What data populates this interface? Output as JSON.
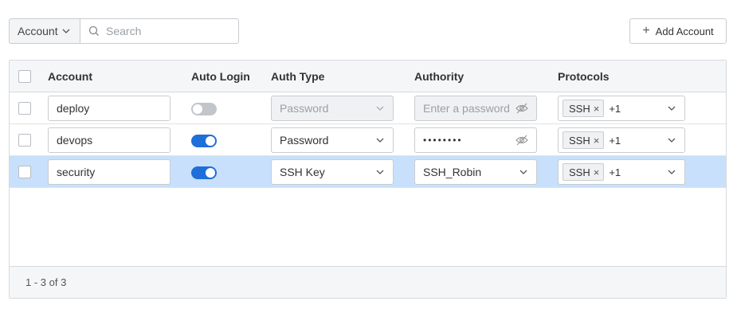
{
  "toolbar": {
    "filter_label": "Account",
    "search_placeholder": "Search",
    "add_button_label": "Add Account"
  },
  "table": {
    "columns": [
      "Account",
      "Auto Login",
      "Auth Type",
      "Authority",
      "Protocols"
    ],
    "rows": [
      {
        "account": "deploy",
        "auto_login": false,
        "auth_type": "Password",
        "auth_type_disabled": true,
        "authority_placeholder": "Enter a password",
        "authority_value": "",
        "protocol_tag": "SSH",
        "protocol_more": "+1",
        "selected": false
      },
      {
        "account": "devops",
        "auto_login": true,
        "auth_type": "Password",
        "auth_type_disabled": false,
        "authority_value": "••••••••",
        "protocol_tag": "SSH",
        "protocol_more": "+1",
        "selected": false
      },
      {
        "account": "security",
        "auto_login": true,
        "auth_type": "SSH Key",
        "auth_type_disabled": false,
        "authority_value": "SSH_Robin",
        "protocol_tag": "SSH",
        "protocol_more": "+1",
        "selected": true
      }
    ],
    "pagination_text": "1 - 3 of 3"
  },
  "colors": {
    "accent": "#1e6fd9",
    "selected_row": "#c8e0fb",
    "header_bg": "#f5f6f7"
  }
}
